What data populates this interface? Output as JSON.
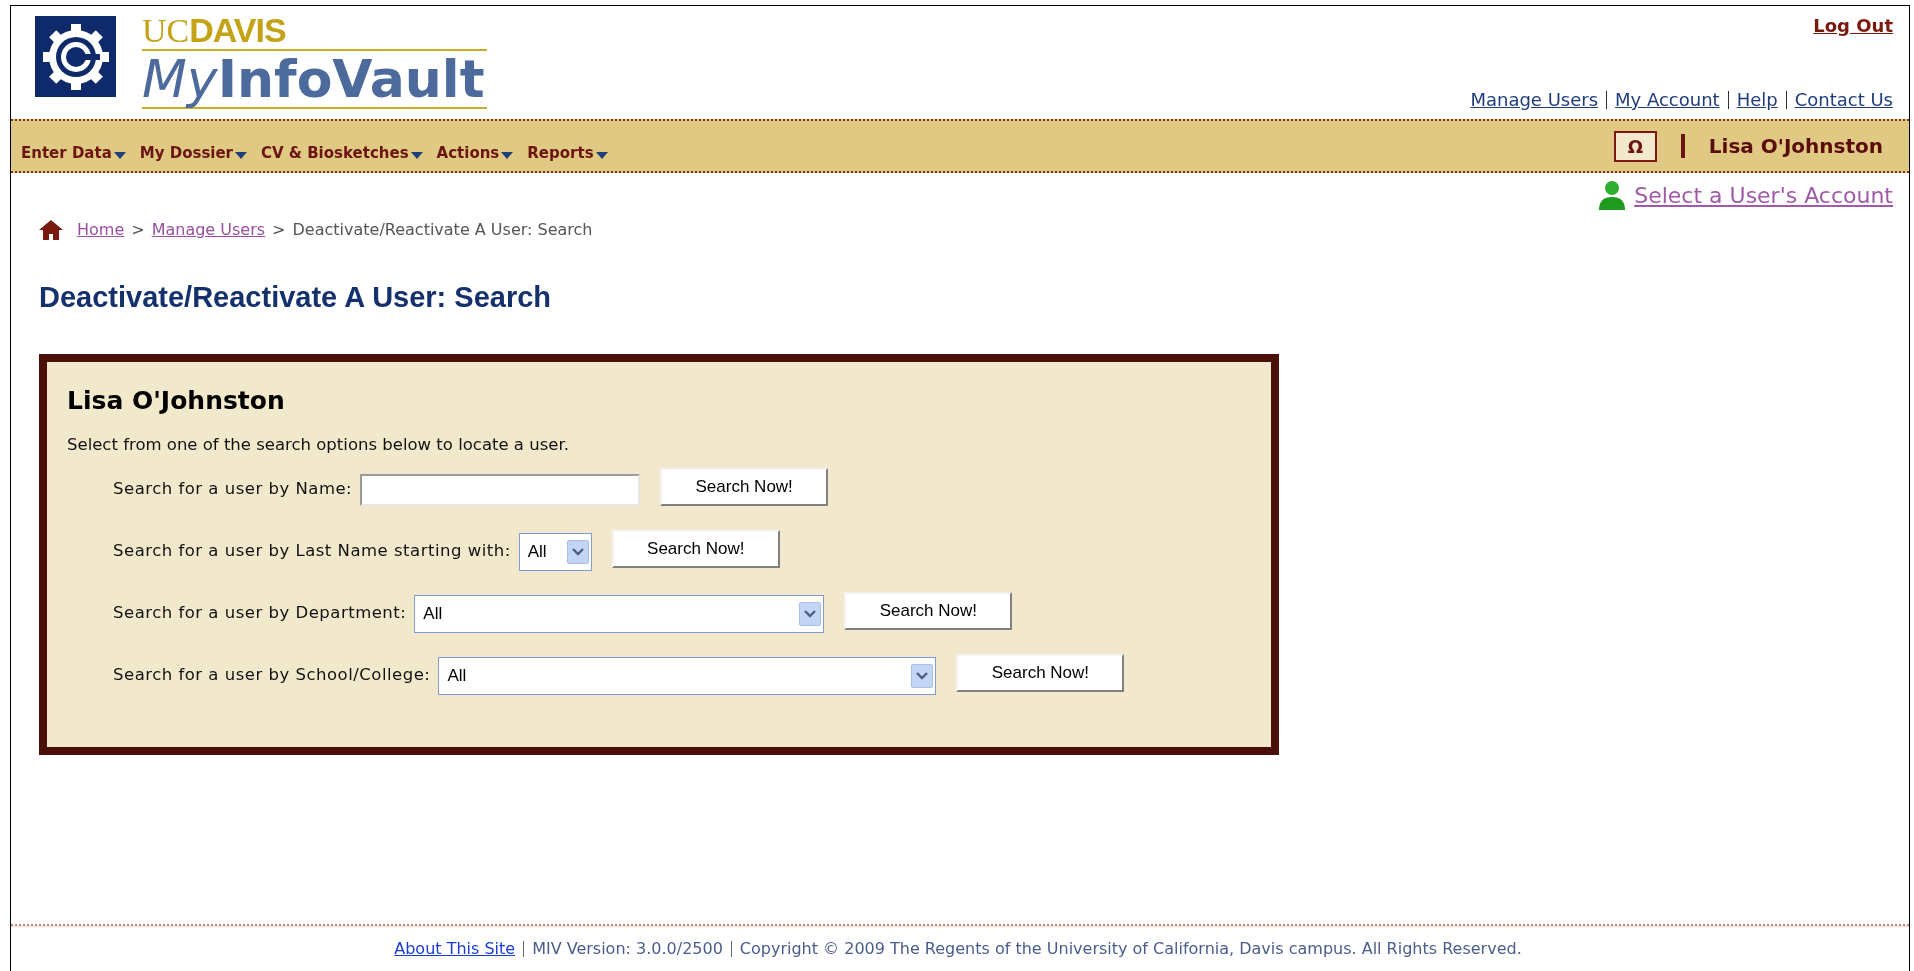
{
  "header": {
    "logo": {
      "uc": "UC",
      "davis": "DAVIS",
      "my": "My",
      "vault": "InfoVault"
    },
    "logout": "Log Out",
    "top_links": [
      "Manage Users",
      "My Account",
      "Help",
      "Contact Us"
    ]
  },
  "nav": {
    "menus": [
      "Enter Data",
      "My Dossier",
      "CV & Biosketches",
      "Actions",
      "Reports"
    ],
    "symbol_button": "Ω",
    "user_name": "Lisa O'Johnston"
  },
  "select_account_link": "Select a User's Account",
  "breadcrumb": [
    {
      "kind": "link",
      "label": "Home"
    },
    {
      "kind": "separator",
      "label": ">"
    },
    {
      "kind": "link",
      "label": "Manage Users"
    },
    {
      "kind": "separator",
      "label": ">"
    },
    {
      "kind": "current",
      "label": "Deactivate/Reactivate A User: Search"
    }
  ],
  "page_title": "Deactivate/Reactivate A User: Search",
  "search_panel": {
    "heading": "Lisa O'Johnston",
    "description": "Select from one of the search options below to locate a user.",
    "rows": [
      {
        "kind": "text",
        "label": "Search for a user by Name:",
        "button": "Search Now!"
      },
      {
        "kind": "select",
        "label": "Search for a user by Last Name starting with:",
        "value": "All",
        "button": "Search Now!"
      },
      {
        "kind": "select",
        "label": "Search for a user by Department:",
        "value": "All",
        "button": "Search Now!"
      },
      {
        "kind": "select",
        "label": "Search for a user by School/College:",
        "value": "All",
        "button": "Search Now!"
      }
    ]
  },
  "footer": {
    "link": "About This Site",
    "items": [
      "MIV Version: 3.0.0/2500",
      "Copyright © 2009 The Regents of the University of California, Davis campus. All Rights Reserved."
    ]
  }
}
